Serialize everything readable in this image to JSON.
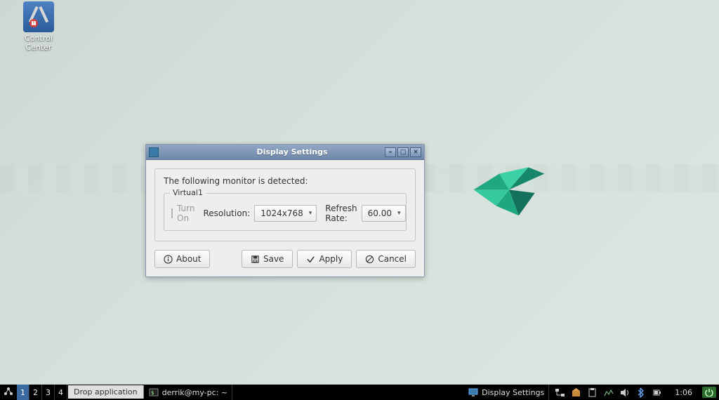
{
  "desktop": {
    "icon_label": "Control Center"
  },
  "window": {
    "title": "Display Settings",
    "message": "The following monitor is detected:",
    "monitor_name": "Virtual1",
    "turn_on_label": "Turn On",
    "resolution_label": "Resolution:",
    "resolution_value": "1024x768",
    "refresh_label": "Refresh Rate:",
    "refresh_value": "60.00",
    "about_label": "About",
    "save_label": "Save",
    "apply_label": "Apply",
    "cancel_label": "Cancel"
  },
  "panel": {
    "workspaces": [
      "1",
      "2",
      "3",
      "4"
    ],
    "drop_label": "Drop application",
    "task_terminal": "derrik@my-pc: ~",
    "task_display": "Display Settings",
    "clock": "1:06"
  }
}
